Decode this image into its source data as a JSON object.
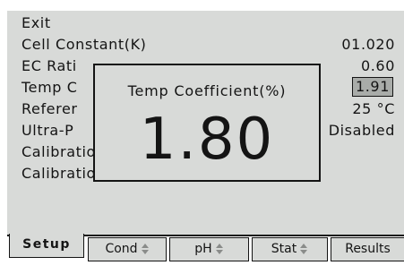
{
  "menu": {
    "items": [
      {
        "label": "Exit",
        "value": ""
      },
      {
        "label": "Cell Constant(K)",
        "value": "01.020"
      },
      {
        "label": "EC Rati",
        "value": "0.60"
      },
      {
        "label": "Temp C",
        "value": "1.91"
      },
      {
        "label": "Referer",
        "value": "25 °C"
      },
      {
        "label": "Ultra-P",
        "value": "Disabled"
      },
      {
        "label": "Calibration Buffer Setup...",
        "value": ""
      },
      {
        "label": "Calibration Reminder Setup...",
        "value": ""
      }
    ]
  },
  "popup": {
    "title": "Temp Coefficient(%)",
    "value": "1.80"
  },
  "tabs": [
    {
      "label": "Setup",
      "arrows": false
    },
    {
      "label": "Cond",
      "arrows": true
    },
    {
      "label": "pH",
      "arrows": true
    },
    {
      "label": "Stat",
      "arrows": true
    },
    {
      "label": "Results",
      "arrows": false
    }
  ],
  "colors": {
    "screen": "#d8dad8",
    "text": "#141414",
    "selected_value_bg": "#a9aca9"
  }
}
